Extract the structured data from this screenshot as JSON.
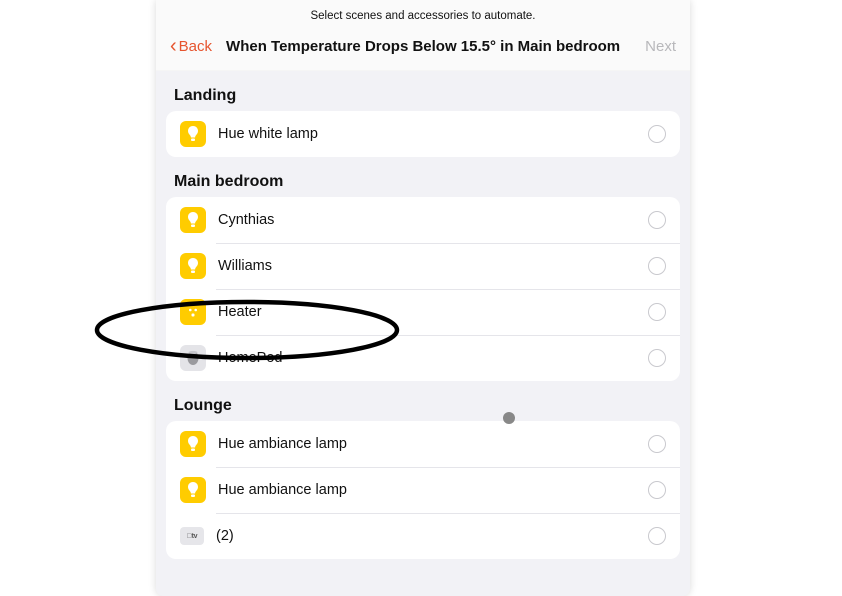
{
  "subtitle": "Select scenes and accessories to automate.",
  "nav": {
    "back": "Back",
    "title": "When Temperature Drops Below 15.5° in Main bedroom",
    "next": "Next"
  },
  "sections": [
    {
      "header": "Landing",
      "rows": [
        {
          "icon": "bulb",
          "iconBg": "yellow",
          "label": "Hue white lamp"
        }
      ]
    },
    {
      "header": "Main bedroom",
      "rows": [
        {
          "icon": "bulb",
          "iconBg": "yellow",
          "label": "Cynthias"
        },
        {
          "icon": "bulb",
          "iconBg": "yellow",
          "label": "Williams"
        },
        {
          "icon": "outlet",
          "iconBg": "yellow",
          "label": "Heater"
        },
        {
          "icon": "homepod",
          "iconBg": "grey",
          "label": "HomePod"
        }
      ]
    },
    {
      "header": "Lounge",
      "rows": [
        {
          "icon": "bulb",
          "iconBg": "yellow",
          "label": "Hue ambiance lamp"
        },
        {
          "icon": "bulb",
          "iconBg": "yellow",
          "label": "Hue ambiance lamp"
        },
        {
          "icon": "tv",
          "iconBg": "darkgrey",
          "label": "(2)"
        }
      ]
    }
  ]
}
